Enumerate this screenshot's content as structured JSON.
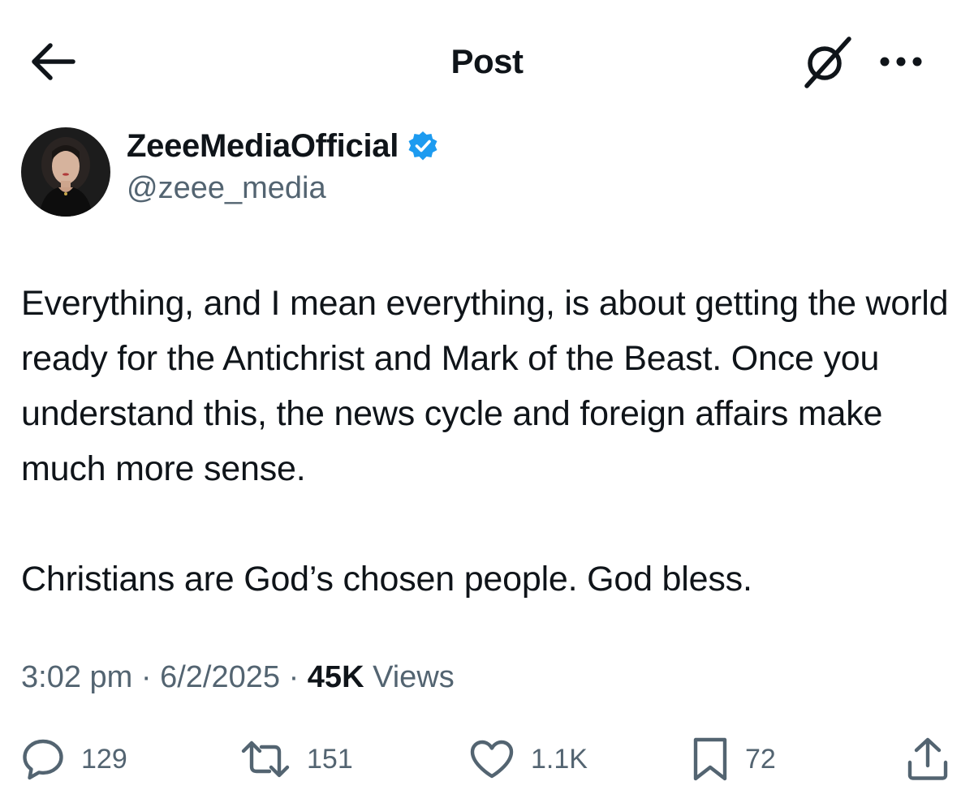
{
  "header": {
    "title": "Post",
    "back_icon": "arrow-left-icon",
    "grok_icon": "grok-icon",
    "more_icon": "more-horizontal-icon"
  },
  "author": {
    "display_name": "ZeeeMediaOfficial",
    "handle": "@zeee_media",
    "verified": true,
    "verified_color": "#1d9bf0"
  },
  "post": {
    "paragraphs": [
      "Everything, and I mean everything, is about getting the world ready for the Antichrist and Mark of the Beast. Once you understand this, the news cycle and foreign affairs make much more sense.",
      "Christians are God’s chosen people. God bless."
    ]
  },
  "meta": {
    "time": "3:02 pm",
    "date": "6/2/2025",
    "views_count": "45K",
    "views_label": "Views",
    "separator": "·"
  },
  "actions": {
    "replies": "129",
    "reposts": "151",
    "likes": "1.1K",
    "bookmarks": "72"
  },
  "colors": {
    "text_primary": "#0f1419",
    "text_secondary": "#536471",
    "background": "#ffffff"
  }
}
